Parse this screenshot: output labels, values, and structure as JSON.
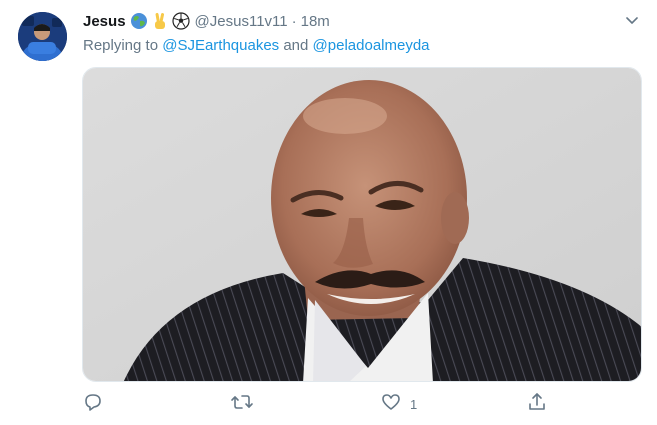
{
  "tweet": {
    "author_name": "Jesus",
    "author_emojis": [
      "globe-icon",
      "victory-hand-icon",
      "soccer-ball-icon"
    ],
    "handle": "@Jesus11v11",
    "separator": "·",
    "time": "18m",
    "reply_prefix": "Replying to",
    "reply_mention_1": "@SJEarthquakes",
    "reply_conjunction": "and",
    "reply_mention_2": "@peladoalmeyda"
  },
  "actions": {
    "reply_icon": "reply-icon",
    "retweet_icon": "retweet-icon",
    "like_icon": "heart-icon",
    "like_count": "1",
    "share_icon": "share-icon"
  },
  "colors": {
    "text_primary": "#14171a",
    "text_secondary": "#657786",
    "link": "#1b95e0"
  }
}
